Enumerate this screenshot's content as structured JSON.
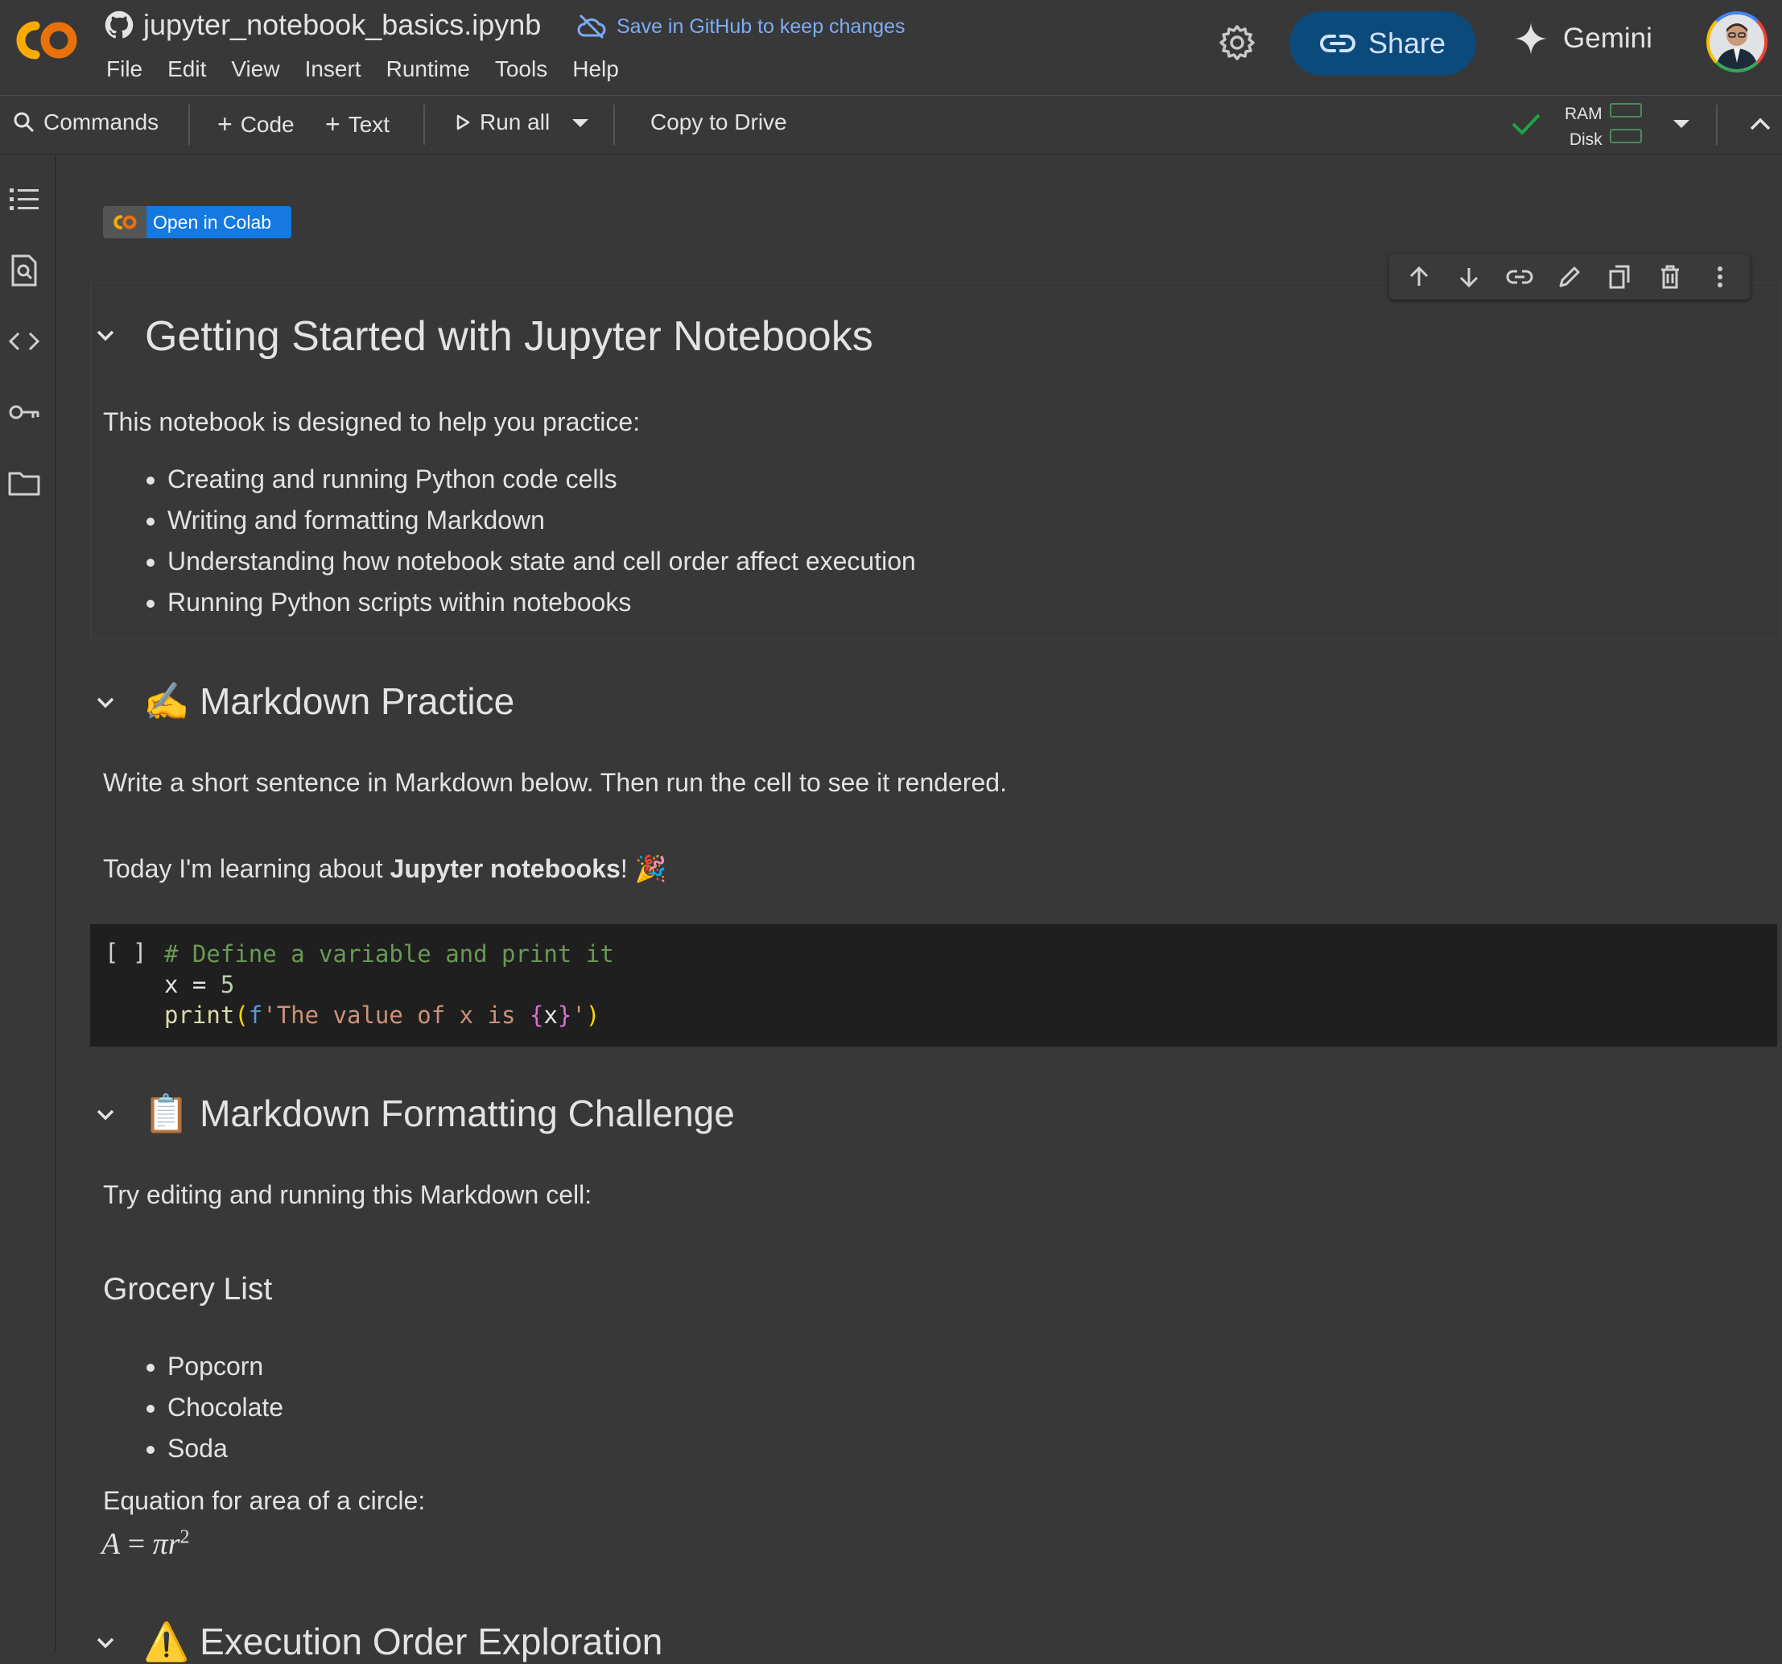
{
  "header": {
    "notebook_title": "jupyter_notebook_basics.ipynb",
    "save_notice": "Save in GitHub to keep changes",
    "menu": [
      "File",
      "Edit",
      "View",
      "Insert",
      "Runtime",
      "Tools",
      "Help"
    ],
    "share_label": "Share",
    "gemini_label": "Gemini"
  },
  "toolbar": {
    "commands": "Commands",
    "code": "Code",
    "text": "Text",
    "run_all": "Run all",
    "copy_to_drive": "Copy to Drive",
    "ram": "RAM",
    "disk": "Disk"
  },
  "badge": {
    "text": "Open in Colab"
  },
  "cell1": {
    "title": "Getting Started with Jupyter Notebooks",
    "intro": "This notebook is designed to help you practice:",
    "items": [
      "Creating and running Python code cells",
      "Writing and formatting Markdown",
      "Understanding how notebook state and cell order affect execution",
      "Running Python scripts within notebooks"
    ]
  },
  "cell2": {
    "emoji": "✍️",
    "title": "Markdown Practice",
    "instruction": "Write a short sentence in Markdown below. Then run the cell to see it rendered.",
    "sentence_pre": "Today I'm learning about ",
    "sentence_bold": "Jupyter notebooks",
    "sentence_post": "! 🎉"
  },
  "code_cell": {
    "exec_count": "[ ]",
    "comment": "# Define a variable and print it",
    "line2_var": "x",
    "line2_eq": " = ",
    "line2_num": "5",
    "line3_fn": "print",
    "line3_open": "(",
    "line3_f": "f",
    "line3_str1": "'The value of x is ",
    "line3_brace_open": "{",
    "line3_x": "x",
    "line3_brace_close": "}",
    "line3_str2": "'",
    "line3_close": ")"
  },
  "cell3": {
    "emoji": "📋",
    "title": "Markdown Formatting Challenge",
    "instruction": "Try editing and running this Markdown cell:",
    "subheading": "Grocery List",
    "items": [
      "Popcorn",
      "Chocolate",
      "Soda"
    ],
    "equation_label": "Equation for area of a circle:",
    "equation_lhs": "A",
    "equation_eq": " = ",
    "equation_rhs": "πr",
    "equation_exp": "2"
  },
  "cell4": {
    "emoji": "⚠️",
    "title": "Execution Order Exploration"
  },
  "colors": {
    "accent_blue": "#7cacf8",
    "share_bg": "#0b4a7a",
    "code_bg": "#1f1f1f",
    "status_green": "#1ea446"
  }
}
